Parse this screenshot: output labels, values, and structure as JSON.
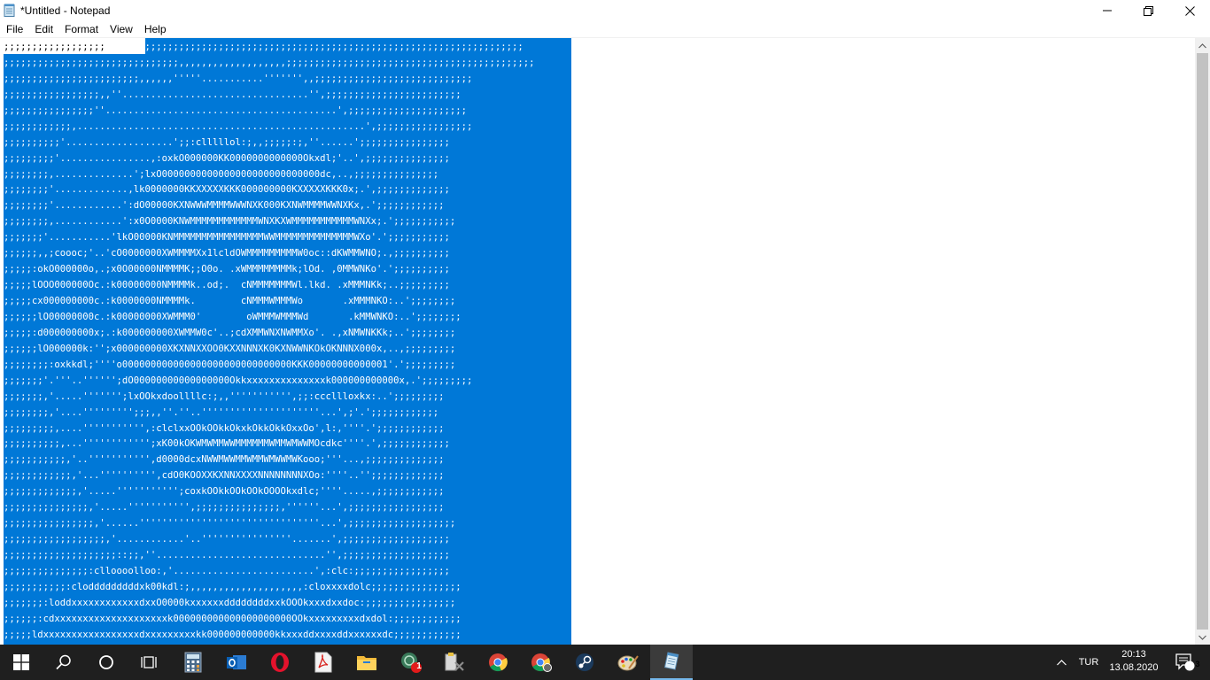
{
  "window": {
    "title": "*Untitled - Notepad"
  },
  "menu": [
    "File",
    "Edit",
    "Format",
    "View",
    "Help"
  ],
  "editor": {
    "lines": [
      ";;;;;;;;;;;;;;;;;;;;;;;;;;;;;;;;;;;;;;;;;;;;;;;;;;;;;;;;;;;;;;;;;;;;;;;;;;;;;;;;;;;;;;;;;;;;",
      ";;;;;;;;;;;;;;;;;;;;;;;;;;;;;;;,,,,,,,,,,,,,,,,,,,;;;;;;;;;;;;;;;;;;;;;;;;;;;;;;;;;;;;;;;;;;;;",
      ";;;;;;;;;;;;;;;;;;;;;;;;,,,,,,'''''...........''''''',,;;;;;;;;;;;;;;;;;;;;;;;;;;;;",
      ";;;;;;;;;;;;;;;;;,,''.................................'',;;;;;;;;;;;;;;;;;;;;;;;;",
      ";;;;;;;;;;;;;;;;''.........................................',;;;;;;;;;;;;;;;;;;;;;",
      ";;;;;;;;;;;;,...................................................',;;;;;;;;;;;;;;;;;",
      ";;;;;;;;;;'...................';;:clllllol:;,,;;;;;:;,''......';;;;;;;;;;;;;;;;",
      ";;;;;;;;;'................,:oxkO000000KK0000000000000Okxdl;'..',;;;;;;;;;;;;;;;",
      ";;;;;;;;,..............';lxO0000000000000000000000000000dc,..,;;;;;;;;;;;;;;;",
      ";;;;;;;;'.............,lk0000000KKXXXXXKKK000000000KXXXXXKKK0x;.',;;;;;;;;;;;;;",
      ";;;;;;;;'............':dO00000KXNWWWMMMMWWWNXK000KXNWMMMMWWNXKx,.';;;;;;;;;;;;",
      ";;;;;;;;,............':x0O0000KNWMMMMMMMMMMMMWNXKXWMMMMMMMMMMMWNXx;.';;;;;;;;;;;",
      ";;;;;;;'...........'lkO00000KNMMMMMMMMMMMMMMMMWWMMMMMMMMMMMMMMWXo'.';;;;;;;;;;;",
      ";;;;;;,,;coooc;'..'cO0000000XWMMMMXx1lcldOWMMMMMMMMMW0oc::dKWMMWNO;.,;;;;;;;;;;",
      ";;;;;:okO000000o,.;x0O00000NMMMMK;;O0o. .xWMMMMMMMMk;lOd. ,0MMWNKo'.';;;;;;;;;;",
      ";;;;;lOOO000000Oc.:k00000000NMMMMk..od;.  cNMMMMMMMWl.lkd. .xMMMNKk;..;;;;;;;;;",
      ";;;;;cx000000000c.:k0000000NMMMMk.        cNMMMWMMMWo       .xMMMNKO:..';;;;;;;;",
      ";;;;;;lO00000000c.:k00000000XWMMM0'        oWMMMWMMMWd       .kMMWNKO:..';;;;;;;;",
      ";;;;;:d000000000x;.:k000000000XWMMW0c'..;cdXMMWNXNWMMXo'. .,xNMWNKKk;..';;;;;;;;",
      ";;;;;;lO000000k:'';x000000000XKXNNXXOO0KXXNNNXK0KXNWWNKOkOKNNNX000x,..,;;;;;;;;;",
      ";;;;;;;;:oxkkdl;''''o000000000000000000000000000000KKK00000000000001'.';;;;;;;;;",
      ";;;;;;;'.'''..'''''';dO00000000000000000Okkxxxxxxxxxxxxxxk000000000000x,.';;;;;;;;;",
      ";;;;;;;,'.....''''''';lxOOkxdoollllc:;,,''''''''''',;;:cccllloxkx:..';;;;;;;;;",
      ";;;;;;;;,'....''''''''';;;,,''.''..'''''''''''''''''''''...',;'.';;;;;;;;;;;;",
      ";;;;;;;;;,....''''''''''',:clclxxOOkOOkkOkxkOkkOkkOxxOo',l:,''''.';;;;;;;;;;;;",
      ";;;;;;;;;;,...'''''''''''';xK00kOKWMWMMWWMMMMMMWMMWMWWMOcdkc''''.',;;;;;;;;;;;;",
      ";;;;;;;;;;;,'..''''''''''',d0000dcxNWWMWWMMWMMWMWWMWKooo;'''...,;;;;;;;;;;;;;;",
      ";;;;;;;;;;;;,'...'''''''''',cdO0KOOXXKXNNXXXXNNNNNNNNXOo:''''..'';;;;;;;;;;;;;",
      ";;;;;;;;;;;;;,'.....''''''''''';coxkOOkkOOkOOkOOOOkxdlc;''''.....,;;;;;;;;;;;;",
      ";;;;;;;;;;;;;;;,'.....''''''''''',;;;;;;;;;;;;;;;,''''''...',;;;;;;;;;;;;;;;;;",
      ";;;;;;;;;;;;;;;;,'......''''''''''''''''''''''''''''''''...',;;;;;;;;;;;;;;;;;;;",
      ";;;;;;;;;;;;;;;;;;,'............'..''''''''''''''''.......',;;;;;;;;;;;;;;;;;;;",
      ";;;;;;;;;;;;;;;;;;;;::;;,''..............................'',;;;;;;;;;;;;;;;;;;;",
      ";;;;;;;;;;;;;;;:clloooolloo:,'.........................',:clc:;;;;;;;;;;;;;;;;;",
      ";;;;;;;;;;;:clodddddddddxk00kdl:;,,,,,,,,,,,,,,,,,,,,:cloxxxxdolc;;;;;;;;;;;;;;;;",
      ";;;;;;;:loddxxxxxxxxxxxxdxxO0000kxxxxxxddddddddxxkOOOkxxxdxxdoc:;;;;;;;;;;;;;;;;",
      ";;;;;;:cdxxxxxxxxxxxxxxxxxxxxk000000000000000000000OOkxxxxxxxxxdxdol:;;;;;;;;;;;;",
      ";;;;;ldxxxxxxxxxxxxxxxxxdxxxxxxxxxkk000000000000kkxxxddxxxxddxxxxxxdc;;;;;;;;;;;;"
    ]
  },
  "taskbar": {
    "lang": "TUR",
    "time": "20:13",
    "date": "13.08.2020",
    "notification_count": "3",
    "badge_count": "1"
  },
  "colors": {
    "selection": "#0078d7",
    "taskbar": "#1f1f1f"
  }
}
